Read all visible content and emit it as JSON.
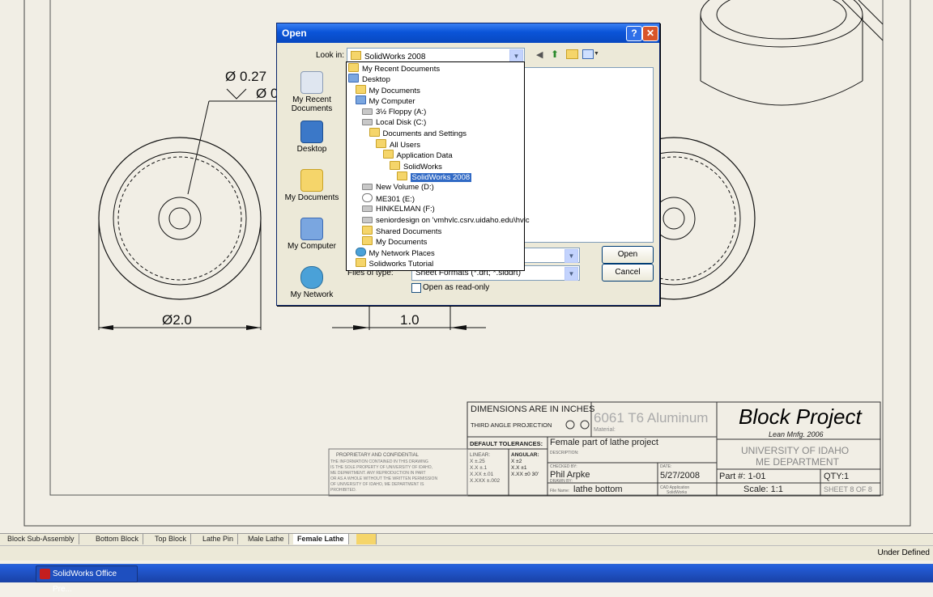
{
  "drawing": {
    "dim_hole": "Ø 0.27",
    "dim_hole_cut": "Ø 0",
    "dim_diameter": "Ø2.0",
    "dim_length": "1.0"
  },
  "title_block": {
    "dims_note": "DIMENSIONS ARE IN INCHES",
    "projection": "THIRD ANGLE PROJECTION",
    "material": "6061 T6 Aluminum",
    "material_label": "Material:",
    "project_title": "Block Project",
    "project_subtitle": "Lean Mnfg. 2006",
    "university": "UNIVERSITY OF IDAHO",
    "department": "ME DEPARTMENT",
    "default_tolerances": "DEFAULT TOLERANCES:",
    "linear": "LINEAR:",
    "lin1": "X ±.25",
    "lin2": "X.X ±.1",
    "lin3": "X.XX ±.01",
    "lin4": "X.XXX ±.002",
    "angular": "ANGULAR:",
    "ang1": "X ±2",
    "ang2": "X.X ±1",
    "ang3": "X.XX ±0 30'",
    "description_label": "DESCRIPTION:",
    "description": "Female part of lathe project",
    "drawn_label": "CHECKED BY:",
    "drawn_by_label": "DRAWN BY:",
    "drawn_by": "Phil Arpke",
    "file_label": "File Name:",
    "file_name": "lathe bottom",
    "date_label": "DATE:",
    "date": "5/27/2008",
    "cad_label": "CAD Application",
    "cad_app": "SolidWorks",
    "part_no": "Part #: 1-01",
    "qty": "QTY:1",
    "scale": "Scale: 1:1",
    "sheet": "SHEET 8 OF 8",
    "proprietary_title": "PROPRIETARY AND CONFIDENTIAL",
    "proprietary_1": "THE INFORMATION CONTAINED IN THIS DRAWING",
    "proprietary_2": "IS THE SOLE PROPERTY OF UNIVERSITY OF IDAHO,",
    "proprietary_3": "ME DEPARTMENT. ANY REPRODUCTION IN PART",
    "proprietary_4": "OR AS A WHOLE WITHOUT THE WRITTEN PERMISSION",
    "proprietary_5": "OF UNIVERSITY OF IDAHO, ME DEPARTMENT IS",
    "proprietary_6": "PROHIBITED."
  },
  "dialog": {
    "title": "Open",
    "help_btn": "?",
    "close_btn": "✕",
    "look_in_label": "Look in:",
    "look_in_value": "SolidWorks 2008",
    "files_of_type_label": "Files of type:",
    "files_of_type_value": "Sheet Formats (*.drt; *.slddrt)",
    "read_only": "Open as read-only",
    "open_btn": "Open",
    "cancel_btn": "Cancel",
    "places": [
      {
        "label": "My Recent Documents"
      },
      {
        "label": "Desktop"
      },
      {
        "label": "My Documents"
      },
      {
        "label": "My Computer"
      },
      {
        "label": "My Network"
      }
    ],
    "dropdown": [
      {
        "label": "My Recent Documents",
        "indent": 0,
        "kind": "folder"
      },
      {
        "label": "Desktop",
        "indent": 0,
        "kind": "comp"
      },
      {
        "label": "My Documents",
        "indent": 1,
        "kind": "folder"
      },
      {
        "label": "My Computer",
        "indent": 1,
        "kind": "comp"
      },
      {
        "label": "3½ Floppy (A:)",
        "indent": 2,
        "kind": "drive"
      },
      {
        "label": "Local Disk (C:)",
        "indent": 2,
        "kind": "drive"
      },
      {
        "label": "Documents and Settings",
        "indent": 3,
        "kind": "folder"
      },
      {
        "label": "All Users",
        "indent": 4,
        "kind": "folder"
      },
      {
        "label": "Application Data",
        "indent": 5,
        "kind": "folder"
      },
      {
        "label": "SolidWorks",
        "indent": 6,
        "kind": "folder"
      },
      {
        "label": "SolidWorks 2008",
        "indent": 7,
        "kind": "folder",
        "selected": true
      },
      {
        "label": "New Volume (D:)",
        "indent": 2,
        "kind": "drive"
      },
      {
        "label": "ME301 (E:)",
        "indent": 2,
        "kind": "cd"
      },
      {
        "label": "HINKELMAN (F:)",
        "indent": 2,
        "kind": "drive"
      },
      {
        "label": "seniordesign on 'vmhvlc.csrv.uidaho.edu\\hvlc",
        "indent": 2,
        "kind": "drive"
      },
      {
        "label": "Shared Documents",
        "indent": 2,
        "kind": "folder"
      },
      {
        "label": "My Documents",
        "indent": 2,
        "kind": "folder"
      },
      {
        "label": "My Network Places",
        "indent": 1,
        "kind": "net"
      },
      {
        "label": "Solidworks Tutorial",
        "indent": 1,
        "kind": "folder"
      }
    ]
  },
  "tabs": [
    {
      "label": "Block Sub-Assembly"
    },
    {
      "label": "Bottom Block"
    },
    {
      "label": "Top Block"
    },
    {
      "label": "Lathe Pin"
    },
    {
      "label": "Male Lathe"
    },
    {
      "label": "Female Lathe",
      "active": true
    }
  ],
  "status": {
    "text": "Under Defined"
  },
  "taskbar": {
    "item": "SolidWorks Office Pre..."
  }
}
